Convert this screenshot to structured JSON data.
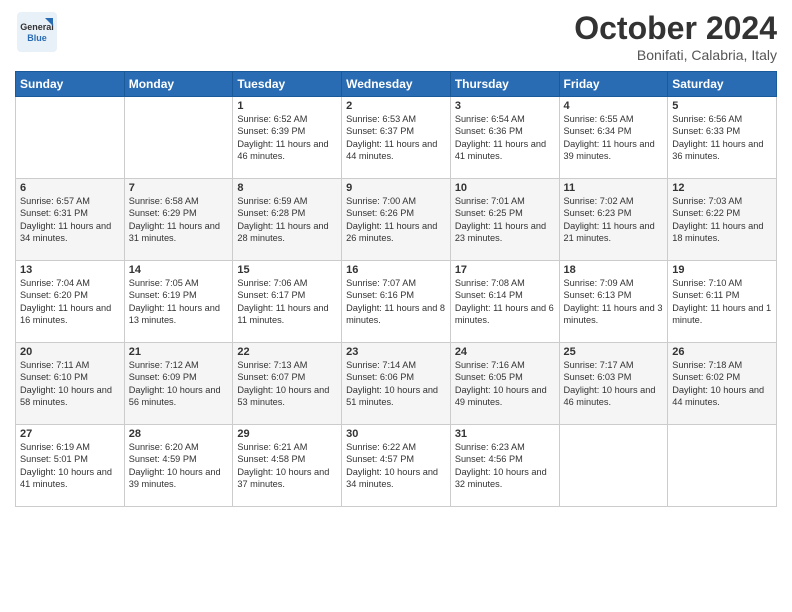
{
  "logo": {
    "general": "General",
    "blue": "Blue"
  },
  "header": {
    "month_title": "October 2024",
    "location": "Bonifati, Calabria, Italy"
  },
  "days_of_week": [
    "Sunday",
    "Monday",
    "Tuesday",
    "Wednesday",
    "Thursday",
    "Friday",
    "Saturday"
  ],
  "weeks": [
    [
      {
        "day": "",
        "info": ""
      },
      {
        "day": "",
        "info": ""
      },
      {
        "day": "1",
        "info": "Sunrise: 6:52 AM\nSunset: 6:39 PM\nDaylight: 11 hours and 46 minutes."
      },
      {
        "day": "2",
        "info": "Sunrise: 6:53 AM\nSunset: 6:37 PM\nDaylight: 11 hours and 44 minutes."
      },
      {
        "day": "3",
        "info": "Sunrise: 6:54 AM\nSunset: 6:36 PM\nDaylight: 11 hours and 41 minutes."
      },
      {
        "day": "4",
        "info": "Sunrise: 6:55 AM\nSunset: 6:34 PM\nDaylight: 11 hours and 39 minutes."
      },
      {
        "day": "5",
        "info": "Sunrise: 6:56 AM\nSunset: 6:33 PM\nDaylight: 11 hours and 36 minutes."
      }
    ],
    [
      {
        "day": "6",
        "info": "Sunrise: 6:57 AM\nSunset: 6:31 PM\nDaylight: 11 hours and 34 minutes."
      },
      {
        "day": "7",
        "info": "Sunrise: 6:58 AM\nSunset: 6:29 PM\nDaylight: 11 hours and 31 minutes."
      },
      {
        "day": "8",
        "info": "Sunrise: 6:59 AM\nSunset: 6:28 PM\nDaylight: 11 hours and 28 minutes."
      },
      {
        "day": "9",
        "info": "Sunrise: 7:00 AM\nSunset: 6:26 PM\nDaylight: 11 hours and 26 minutes."
      },
      {
        "day": "10",
        "info": "Sunrise: 7:01 AM\nSunset: 6:25 PM\nDaylight: 11 hours and 23 minutes."
      },
      {
        "day": "11",
        "info": "Sunrise: 7:02 AM\nSunset: 6:23 PM\nDaylight: 11 hours and 21 minutes."
      },
      {
        "day": "12",
        "info": "Sunrise: 7:03 AM\nSunset: 6:22 PM\nDaylight: 11 hours and 18 minutes."
      }
    ],
    [
      {
        "day": "13",
        "info": "Sunrise: 7:04 AM\nSunset: 6:20 PM\nDaylight: 11 hours and 16 minutes."
      },
      {
        "day": "14",
        "info": "Sunrise: 7:05 AM\nSunset: 6:19 PM\nDaylight: 11 hours and 13 minutes."
      },
      {
        "day": "15",
        "info": "Sunrise: 7:06 AM\nSunset: 6:17 PM\nDaylight: 11 hours and 11 minutes."
      },
      {
        "day": "16",
        "info": "Sunrise: 7:07 AM\nSunset: 6:16 PM\nDaylight: 11 hours and 8 minutes."
      },
      {
        "day": "17",
        "info": "Sunrise: 7:08 AM\nSunset: 6:14 PM\nDaylight: 11 hours and 6 minutes."
      },
      {
        "day": "18",
        "info": "Sunrise: 7:09 AM\nSunset: 6:13 PM\nDaylight: 11 hours and 3 minutes."
      },
      {
        "day": "19",
        "info": "Sunrise: 7:10 AM\nSunset: 6:11 PM\nDaylight: 11 hours and 1 minute."
      }
    ],
    [
      {
        "day": "20",
        "info": "Sunrise: 7:11 AM\nSunset: 6:10 PM\nDaylight: 10 hours and 58 minutes."
      },
      {
        "day": "21",
        "info": "Sunrise: 7:12 AM\nSunset: 6:09 PM\nDaylight: 10 hours and 56 minutes."
      },
      {
        "day": "22",
        "info": "Sunrise: 7:13 AM\nSunset: 6:07 PM\nDaylight: 10 hours and 53 minutes."
      },
      {
        "day": "23",
        "info": "Sunrise: 7:14 AM\nSunset: 6:06 PM\nDaylight: 10 hours and 51 minutes."
      },
      {
        "day": "24",
        "info": "Sunrise: 7:16 AM\nSunset: 6:05 PM\nDaylight: 10 hours and 49 minutes."
      },
      {
        "day": "25",
        "info": "Sunrise: 7:17 AM\nSunset: 6:03 PM\nDaylight: 10 hours and 46 minutes."
      },
      {
        "day": "26",
        "info": "Sunrise: 7:18 AM\nSunset: 6:02 PM\nDaylight: 10 hours and 44 minutes."
      }
    ],
    [
      {
        "day": "27",
        "info": "Sunrise: 6:19 AM\nSunset: 5:01 PM\nDaylight: 10 hours and 41 minutes."
      },
      {
        "day": "28",
        "info": "Sunrise: 6:20 AM\nSunset: 4:59 PM\nDaylight: 10 hours and 39 minutes."
      },
      {
        "day": "29",
        "info": "Sunrise: 6:21 AM\nSunset: 4:58 PM\nDaylight: 10 hours and 37 minutes."
      },
      {
        "day": "30",
        "info": "Sunrise: 6:22 AM\nSunset: 4:57 PM\nDaylight: 10 hours and 34 minutes."
      },
      {
        "day": "31",
        "info": "Sunrise: 6:23 AM\nSunset: 4:56 PM\nDaylight: 10 hours and 32 minutes."
      },
      {
        "day": "",
        "info": ""
      },
      {
        "day": "",
        "info": ""
      }
    ]
  ]
}
